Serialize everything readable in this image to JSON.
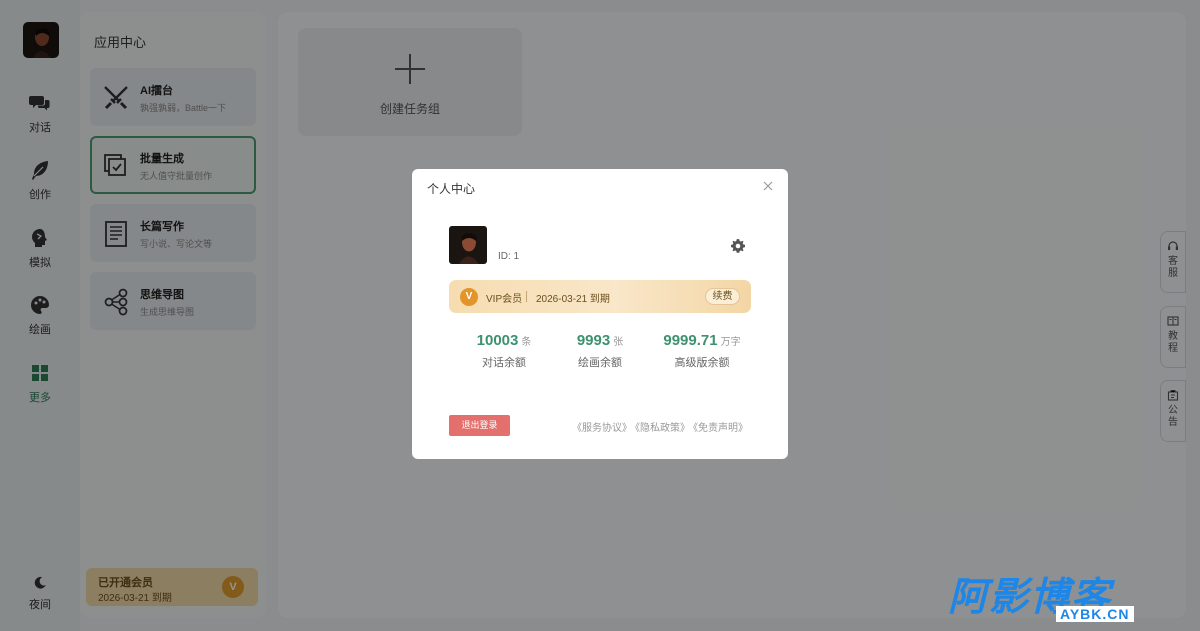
{
  "rail": {
    "items": [
      {
        "label": "对话",
        "icon": "chat-bubbles-icon"
      },
      {
        "label": "创作",
        "icon": "feather-icon"
      },
      {
        "label": "模拟",
        "icon": "head-profile-icon"
      },
      {
        "label": "绘画",
        "icon": "palette-icon"
      },
      {
        "label": "更多",
        "icon": "grid-icon",
        "active": true
      }
    ],
    "night_label": "夜间",
    "accent_color": "#2f7d55"
  },
  "app_center": {
    "title": "应用中心",
    "cards": [
      {
        "title": "AI擂台",
        "subtitle": "孰强孰弱，Battle一下",
        "icon": "crossed-swords-icon"
      },
      {
        "title": "批量生成",
        "subtitle": "无人值守批量创作",
        "icon": "batch-copy-icon",
        "active": true
      },
      {
        "title": "长篇写作",
        "subtitle": "写小说、写论文等",
        "icon": "document-lines-icon"
      },
      {
        "title": "思维导图",
        "subtitle": "生成思维导图",
        "icon": "mindmap-icon"
      }
    ],
    "member": {
      "title": "已开通会员",
      "date": "2026-03-21 到期",
      "badge": "V"
    }
  },
  "main": {
    "create_label": "创建任务组"
  },
  "side_tabs": [
    {
      "label": "客服",
      "icon": "headset-icon"
    },
    {
      "label": "教程",
      "icon": "book-icon"
    },
    {
      "label": "公告",
      "icon": "notice-icon"
    }
  ],
  "modal": {
    "title": "个人中心",
    "user_id": "ID: 1",
    "vip": {
      "badge": "V",
      "label": "VIP会员",
      "date": "2026-03-21 到期",
      "renew": "续费"
    },
    "stats": [
      {
        "value": "10003",
        "unit": "条",
        "label": "对话余额"
      },
      {
        "value": "9993",
        "unit": "张",
        "label": "绘画余额"
      },
      {
        "value": "9999.71",
        "unit": "万字",
        "label": "高级版余额"
      }
    ],
    "logout": "退出登录",
    "links": [
      "《服务协议》",
      "《隐私政策》",
      "《免责声明》"
    ]
  },
  "watermark": {
    "cn": "阿影博客",
    "en": "AYBK.CN",
    "color": "#1e86e6"
  }
}
